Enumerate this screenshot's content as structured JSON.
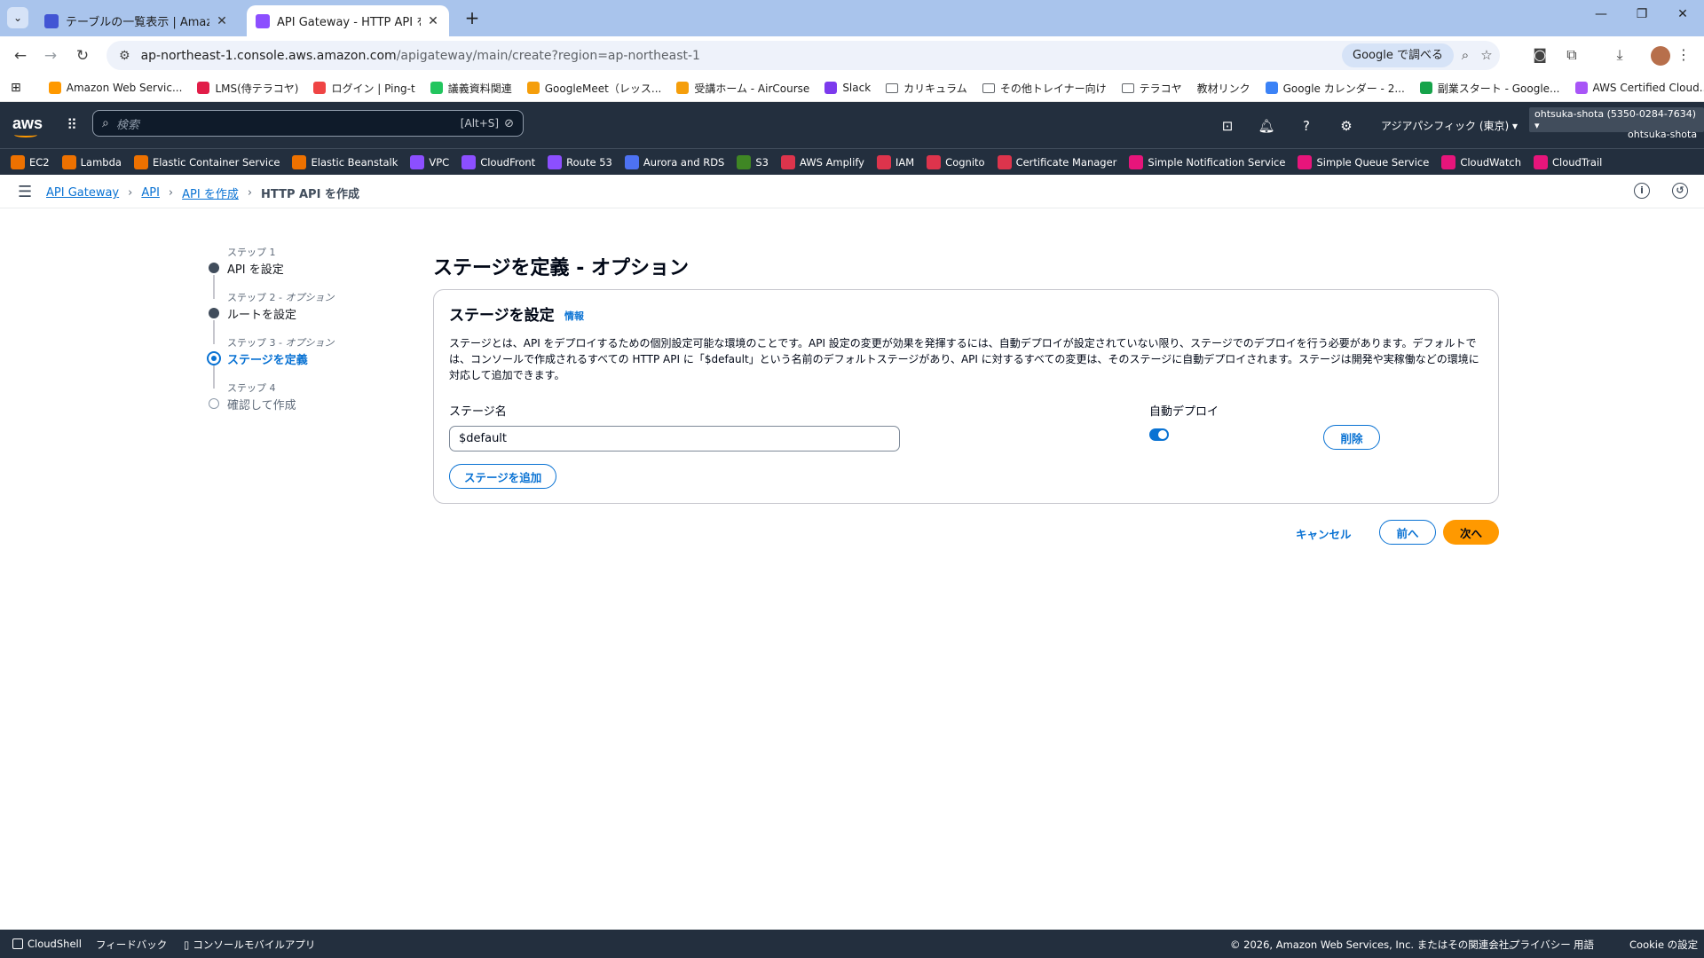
{
  "browser": {
    "tabs": [
      {
        "title": "テーブルの一覧表示 | Amazon Dy",
        "favicon_color": "#4255d4"
      },
      {
        "title": "API Gateway - HTTP API を作成",
        "favicon_color": "#8c4fff"
      }
    ],
    "url_host": "ap-northeast-1.console.aws.amazon.com",
    "url_path": "/apigateway/main/create?region=ap-northeast-1",
    "search_chip": "Google で調べる",
    "bookmarks": [
      {
        "label": "Amazon Web Servic...",
        "color": "#ff9900"
      },
      {
        "label": "LMS(侍テラコヤ)",
        "color": "#e11d48"
      },
      {
        "label": "ログイン | Ping-t",
        "color": "#ef4444"
      },
      {
        "label": "議義資料関連",
        "color": "#22c55e"
      },
      {
        "label": "GoogleMeet（レッス...",
        "color": "#f59e0b"
      },
      {
        "label": "受講ホーム - AirCourse",
        "color": "#f59e0b"
      },
      {
        "label": "Slack",
        "color": "#7c3aed"
      },
      {
        "label": "カリキュラム",
        "folder": true
      },
      {
        "label": "その他トレイナー向け",
        "folder": true
      },
      {
        "label": "テラコヤ",
        "folder": true
      },
      {
        "label": "教材リンク",
        "color": ""
      },
      {
        "label": "Google カレンダー - 2...",
        "color": "#3b82f6"
      },
      {
        "label": "副業スタート - Google...",
        "color": "#16a34a"
      },
      {
        "label": "AWS Certified Cloud...",
        "color": "#a855f7"
      }
    ]
  },
  "aws_header": {
    "logo": "aws",
    "search_placeholder": "検索",
    "search_shortcut": "[Alt+S]",
    "region": "アジアパシフィック (東京) ▾",
    "account": "ohtsuka-shota (5350-0284-7634) ▾",
    "user": "ohtsuka-shota"
  },
  "services": [
    {
      "label": "EC2",
      "color": "#ed7100"
    },
    {
      "label": "Lambda",
      "color": "#ed7100"
    },
    {
      "label": "Elastic Container Service",
      "color": "#ed7100"
    },
    {
      "label": "Elastic Beanstalk",
      "color": "#ed7100"
    },
    {
      "label": "VPC",
      "color": "#8c4fff"
    },
    {
      "label": "CloudFront",
      "color": "#8c4fff"
    },
    {
      "label": "Route 53",
      "color": "#8c4fff"
    },
    {
      "label": "Aurora and RDS",
      "color": "#4d72f3"
    },
    {
      "label": "S3",
      "color": "#3f8624"
    },
    {
      "label": "AWS Amplify",
      "color": "#dd344c"
    },
    {
      "label": "IAM",
      "color": "#dd344c"
    },
    {
      "label": "Cognito",
      "color": "#dd344c"
    },
    {
      "label": "Certificate Manager",
      "color": "#dd344c"
    },
    {
      "label": "Simple Notification Service",
      "color": "#e7157b"
    },
    {
      "label": "Simple Queue Service",
      "color": "#e7157b"
    },
    {
      "label": "CloudWatch",
      "color": "#e7157b"
    },
    {
      "label": "CloudTrail",
      "color": "#e7157b"
    }
  ],
  "breadcrumb": {
    "items": [
      "API Gateway",
      "API",
      "API を作成"
    ],
    "current": "HTTP API を作成"
  },
  "steps": [
    {
      "label": "ステップ 1",
      "option": "",
      "title": "API を設定",
      "state": "done"
    },
    {
      "label": "ステップ 2 - ",
      "option": "オプション",
      "title": "ルートを設定",
      "state": "done"
    },
    {
      "label": "ステップ 3 - ",
      "option": "オプション",
      "title": "ステージを定義",
      "state": "current"
    },
    {
      "label": "ステップ 4",
      "option": "",
      "title": "確認して作成",
      "state": "todo"
    }
  ],
  "main": {
    "page_title": "ステージを定義 - オプション",
    "panel_title": "ステージを設定",
    "info_link": "情報",
    "description": "ステージとは、API をデプロイするための個別設定可能な環境のことです。API 設定の変更が効果を発揮するには、自動デプロイが設定されていない限り、ステージでのデプロイを行う必要があります。デフォルトでは、コンソールで作成されるすべての HTTP API に「$default」という名前のデフォルトステージがあり、API に対するすべての変更は、そのステージに自動デプロイされます。ステージは開発や実稼働などの環境に対応して追加できます。",
    "stage_name_label": "ステージ名",
    "stage_name_value": "$default",
    "auto_deploy_label": "自動デプロイ",
    "auto_deploy_enabled": true,
    "delete_button": "削除",
    "add_stage_button": "ステージを追加",
    "cancel_button": "キャンセル",
    "prev_button": "前へ",
    "next_button": "次へ"
  },
  "footer": {
    "cloudshell": "CloudShell",
    "feedback": "フィードバック",
    "mobile_app": "コンソールモバイルアプリ",
    "copyright": "© 2026, Amazon Web Services, Inc. またはその関連会社。",
    "privacy": "プライバシー",
    "terms": "用語",
    "cookie": "Cookie の設定"
  }
}
